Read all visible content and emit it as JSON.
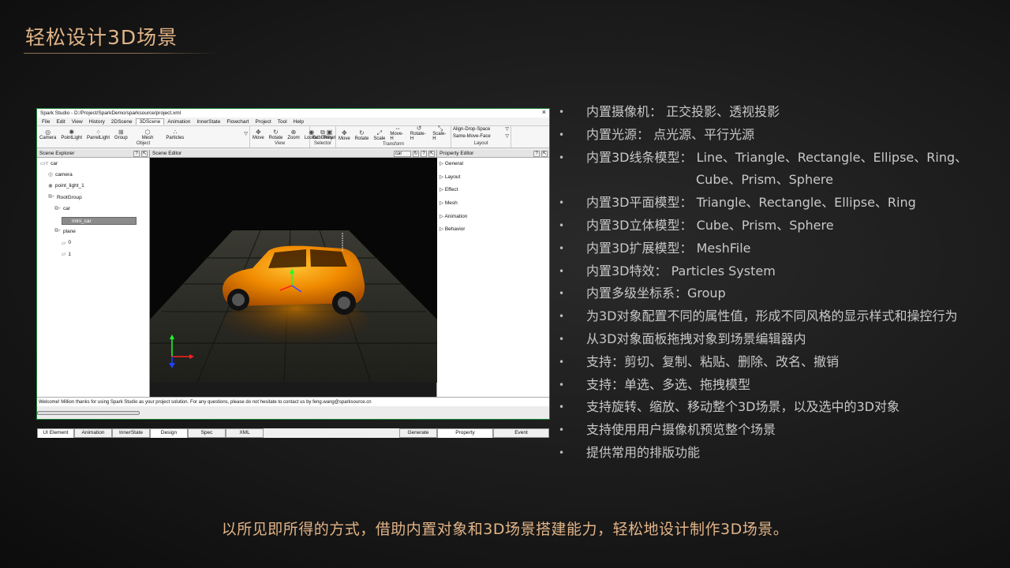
{
  "slide": {
    "title": "轻松设计3D场景",
    "footer": "以所见即所得的方式，借助内置对象和3D场景搭建能力，轻松地设计制作3D场景。",
    "accent_color": "#e2b487",
    "features": [
      {
        "text": "内置摄像机：  正交投影、透视投影"
      },
      {
        "text": "内置光源：  点光源、平行光源"
      },
      {
        "text": "内置3D线条模型：  Line、Triangle、Rectangle、Ellipse、Ring、"
      },
      {
        "text": "Cube、Prism、Sphere",
        "continuation": true
      },
      {
        "text": "内置3D平面模型：  Triangle、Rectangle、Ellipse、Ring"
      },
      {
        "text": "内置3D立体模型：  Cube、Prism、Sphere"
      },
      {
        "text": "内置3D扩展模型：  MeshFile"
      },
      {
        "text": "内置3D特效：  Particles  System"
      },
      {
        "text": "内置多级坐标系：Group"
      },
      {
        "text": "为3D对象配置不同的属性值，形成不同风格的显示样式和操控行为"
      },
      {
        "text": "从3D对象面板拖拽对象到场景编辑器内"
      },
      {
        "text": "支持：剪切、复制、粘贴、删除、改名、撤销"
      },
      {
        "text": "支持：单选、多选、拖拽模型"
      },
      {
        "text": "支持旋转、缩放、移动整个3D场景，以及选中的3D对象"
      },
      {
        "text": "支持使用用户摄像机预览整个场景"
      },
      {
        "text": "提供常用的排版功能"
      }
    ],
    "bullet": "•"
  },
  "app": {
    "window_title": "Spark Studio - D:/Project/SparkDemo/sparksource/project.xml",
    "close_label": "×",
    "menu": [
      "File",
      "Edit",
      "View",
      "History",
      "2DScene",
      "3DScene",
      "Animation",
      "InnerState",
      "Flowchart",
      "Project",
      "Tool",
      "Help"
    ],
    "active_menu": "3DScene",
    "toolbar_groups": [
      {
        "label": "Object",
        "buttons": [
          {
            "label": "Camera",
            "icon": "camera-icon",
            "glyph": "◎"
          },
          {
            "label": "PointLight",
            "icon": "point-light-icon",
            "glyph": "✺"
          },
          {
            "label": "ParrelLight",
            "icon": "parallel-light-icon",
            "glyph": "⁘"
          },
          {
            "label": "Group",
            "icon": "group-icon",
            "glyph": "⊞"
          },
          {
            "label": "Mesh",
            "icon": "mesh-icon",
            "glyph": "⬡"
          },
          {
            "label": "Particles",
            "icon": "particles-icon",
            "glyph": "∴"
          }
        ]
      },
      {
        "label": "View",
        "buttons": [
          {
            "label": "Move",
            "icon": "move-icon",
            "glyph": "✥"
          },
          {
            "label": "Rotate",
            "icon": "rotate-icon",
            "glyph": "↻"
          },
          {
            "label": "Zoom",
            "icon": "zoom-icon",
            "glyph": "⊕"
          },
          {
            "label": "Lookat",
            "icon": "lookat-icon",
            "glyph": "◉"
          },
          {
            "label": "Reset",
            "icon": "reset-icon",
            "glyph": "▣"
          }
        ]
      },
      {
        "label": "Selector",
        "buttons": [
          {
            "label": "SubEntity",
            "icon": "subentity-icon",
            "glyph": "⧉"
          }
        ]
      },
      {
        "label": "Transform",
        "buttons": [
          {
            "label": "Move",
            "icon": "move-icon",
            "glyph": "✥"
          },
          {
            "label": "Rotate",
            "icon": "rotate-icon",
            "glyph": "↻"
          },
          {
            "label": "Scale",
            "icon": "scale-icon",
            "glyph": "⤢"
          },
          {
            "label": "Move-H",
            "icon": "move-h-icon",
            "glyph": "⇔"
          },
          {
            "label": "Rotate-H",
            "icon": "rotate-h-icon",
            "glyph": "↺"
          },
          {
            "label": "Scale-H",
            "icon": "scale-h-icon",
            "glyph": "⤡"
          }
        ]
      },
      {
        "label": "Layout",
        "selects": [
          "Align-Drop-Space",
          "Same-Move-Face"
        ]
      }
    ],
    "scene_explorer": {
      "title": "Scene Explorer",
      "help": "?",
      "pin": "⇱",
      "nodes": [
        {
          "label": "car",
          "icon": "scene-icon",
          "glyph": "▭▿",
          "depth": 0
        },
        {
          "label": "camera",
          "icon": "camera-icon",
          "glyph": "◎",
          "depth": 1
        },
        {
          "label": "point_light_1",
          "icon": "point-light-icon",
          "glyph": "✺",
          "depth": 1
        },
        {
          "label": "RootGroup",
          "icon": "group-icon",
          "glyph": "⧉▿",
          "depth": 1
        },
        {
          "label": "car",
          "icon": "group-icon",
          "glyph": "⧉▿",
          "depth": 2
        },
        {
          "label": "mini_car",
          "icon": "mesh-icon",
          "glyph": "⬡",
          "depth": 3,
          "selected": true
        },
        {
          "label": "plane",
          "icon": "group-icon",
          "glyph": "⧉▿",
          "depth": 2
        },
        {
          "label": "0",
          "icon": "plane-icon",
          "glyph": "▱",
          "depth": 3
        },
        {
          "label": "1",
          "icon": "plane-icon",
          "glyph": "▱",
          "depth": 3
        }
      ],
      "tabs": [
        "UI Element",
        "Animation",
        "InnerState"
      ]
    },
    "scene_editor": {
      "title": "Scene Editor",
      "scene_select": "car",
      "help": "?",
      "tabs": [
        "Design",
        "Spec",
        "XML"
      ],
      "generate_label": "Generate"
    },
    "property_editor": {
      "title": "Property Editor",
      "help": "?",
      "sections": [
        "General",
        "Layout",
        "Effect",
        "Mesh",
        "Animation",
        "Behavior"
      ],
      "tabs": [
        "Property",
        "Event"
      ]
    },
    "status_message": "Welcome! Million thanks for using Spark Studio as your project solution. For any questions, please do not hesitate to contact us by feng.wang@sparksource.cn"
  }
}
